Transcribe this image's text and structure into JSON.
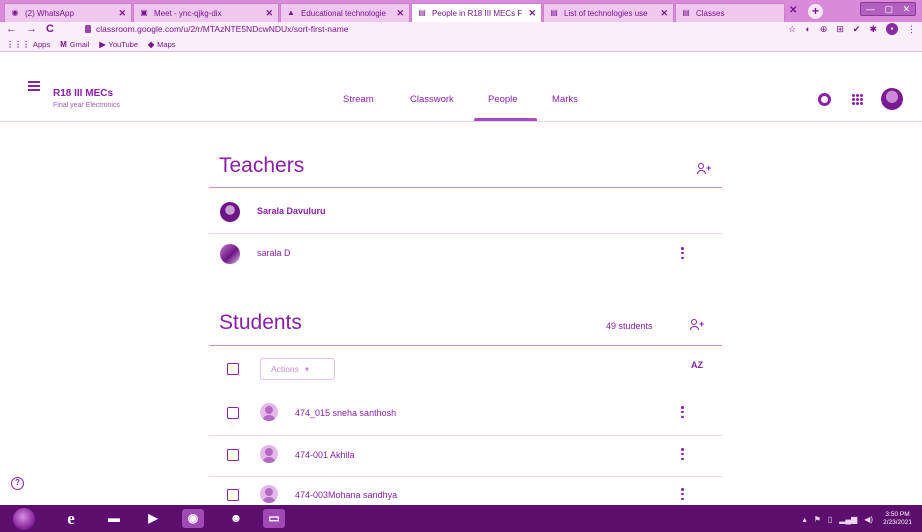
{
  "browser": {
    "tabs": [
      {
        "label": "(2) WhatsApp",
        "icon": "whatsapp-icon",
        "active": false
      },
      {
        "label": "Meet - ync-qjkg-dix",
        "icon": "meet-icon",
        "active": false
      },
      {
        "label": "Educational technologie",
        "icon": "drive-icon",
        "active": false
      },
      {
        "label": "People in R18 III MECs F",
        "icon": "classroom-icon",
        "active": true
      },
      {
        "label": "List of technologies use",
        "icon": "docs-icon",
        "active": false
      },
      {
        "label": "Classes",
        "icon": "classroom-icon",
        "active": false
      }
    ],
    "url": "classroom.google.com/u/2/r/MTAzNTE5NDcwNDUx/sort-first-name",
    "bookmarks": [
      {
        "label": "Apps",
        "icon": "apps-grid-icon"
      },
      {
        "label": "Gmail",
        "icon": "gmail-icon"
      },
      {
        "label": "YouTube",
        "icon": "youtube-icon"
      },
      {
        "label": "Maps",
        "icon": "maps-icon"
      }
    ]
  },
  "header": {
    "class_name": "R18 III MECs",
    "class_subtitle": "Final year Electronics",
    "nav_tabs": [
      "Stream",
      "Classwork",
      "People",
      "Marks"
    ],
    "active_tab": "People"
  },
  "teachers": {
    "title": "Teachers",
    "list": [
      {
        "name": "Sarala Davuluru"
      },
      {
        "name": "sarala D"
      }
    ]
  },
  "students": {
    "title": "Students",
    "count_label": "49 students",
    "actions_label": "Actions",
    "sort_label": "AZ",
    "list": [
      {
        "name": "474_015 sneha santhosh"
      },
      {
        "name": "474-001 Akhila"
      },
      {
        "name": "474-003Mohana sandhya"
      }
    ]
  },
  "taskbar": {
    "time": "3:50 PM",
    "date": "2/23/2021"
  },
  "colors": {
    "accent": "#8a1fa8",
    "taskbar": "#5d0f6f",
    "tab_bg": "#d98ad9"
  }
}
